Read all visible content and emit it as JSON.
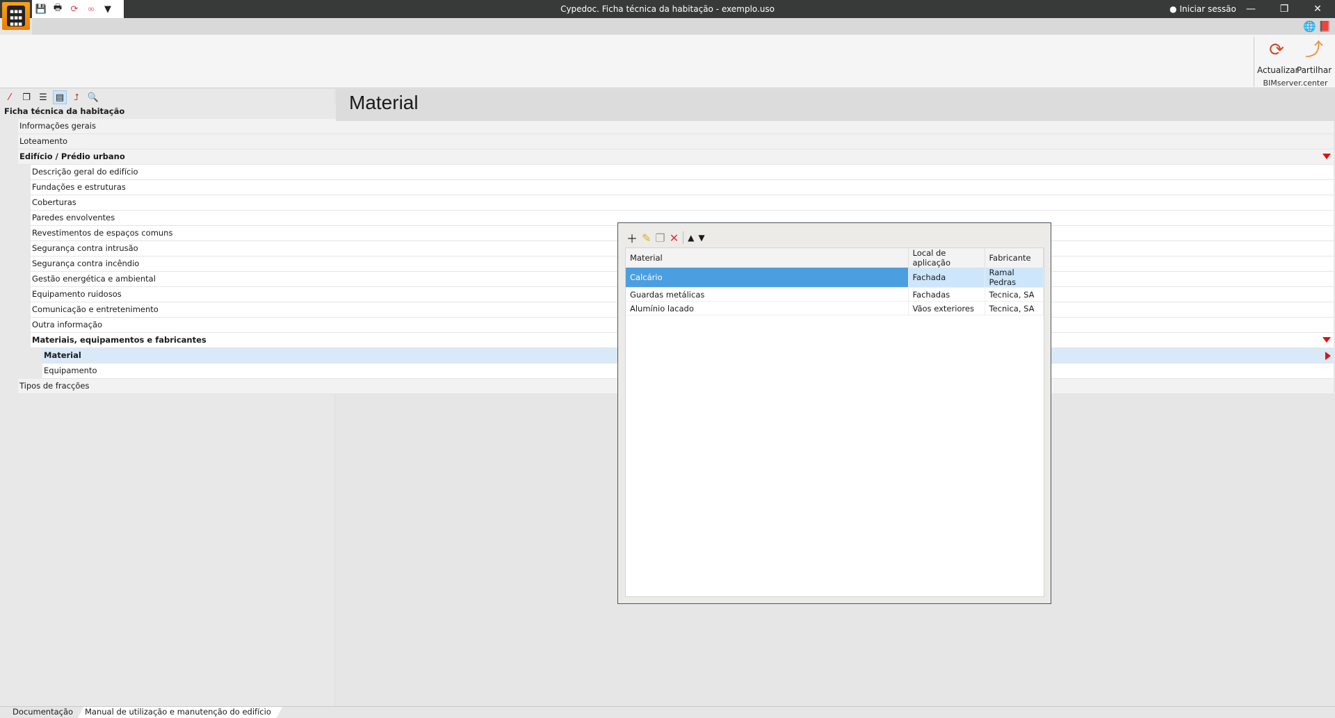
{
  "window": {
    "title": "Cypedoc. Ficha técnica da habitação - exemplo.uso",
    "session": "Iniciar sessão",
    "minimize": "—",
    "restore": "❐",
    "close": "✕"
  },
  "quick_access": [
    "save-icon",
    "print-icon",
    "refresh-icon",
    "share-icon",
    "dropdown-icon"
  ],
  "ribbon": {
    "group": "BIMserver.center",
    "buttons": [
      {
        "label": "Actualizar",
        "icon": "bimserver-refresh-icon"
      },
      {
        "label": "Partilhar",
        "icon": "bimserver-share-icon"
      }
    ]
  },
  "tree": {
    "header": "Ficha técnica da habitação",
    "items": [
      {
        "label": "Informações gerais",
        "level": 0
      },
      {
        "label": "Loteamento",
        "level": 0
      },
      {
        "label": "Edifício / Prédio urbano",
        "level": 0,
        "bold": true,
        "expanded": true
      },
      {
        "label": "Descrição geral do edifício",
        "level": 1
      },
      {
        "label": "Fundações e estruturas",
        "level": 1
      },
      {
        "label": "Coberturas",
        "level": 1
      },
      {
        "label": "Paredes envolventes",
        "level": 1
      },
      {
        "label": "Revestimentos de espaços comuns",
        "level": 1
      },
      {
        "label": "Segurança contra intrusão",
        "level": 1
      },
      {
        "label": "Segurança contra incêndio",
        "level": 1
      },
      {
        "label": "Gestão energética e ambiental",
        "level": 1
      },
      {
        "label": "Equipamento ruidosos",
        "level": 1
      },
      {
        "label": "Comunicação e entretenimento",
        "level": 1
      },
      {
        "label": "Outra informação",
        "level": 1
      },
      {
        "label": "Materiais, equipamentos e fabricantes",
        "level": 1,
        "bold": true,
        "expanded": true
      },
      {
        "label": "Material",
        "level": 2,
        "bold": true,
        "selected": true
      },
      {
        "label": "Equipamento",
        "level": 2
      },
      {
        "label": "Tipos de fracções",
        "level": 0
      }
    ]
  },
  "main": {
    "title": "Material",
    "table": {
      "columns": [
        "Material",
        "Local de aplicação",
        "Fabricante"
      ],
      "rows": [
        [
          "Calcário",
          "Fachada",
          "Ramal Pedras"
        ],
        [
          "Guardas metálicas",
          "Fachadas",
          "Tecnica, SA"
        ],
        [
          "Alumínio lacado",
          "Vãos exteriores",
          "Tecnica, SA"
        ]
      ],
      "selected_row": 0
    }
  },
  "bottom_tabs": [
    "Documentação",
    "Manual de utilização e manutenção do edifício"
  ],
  "colors": {
    "accent": "#4b9fe0",
    "titlebar": "#383a39",
    "arrow": "#e01010",
    "logo": "#f39200"
  }
}
